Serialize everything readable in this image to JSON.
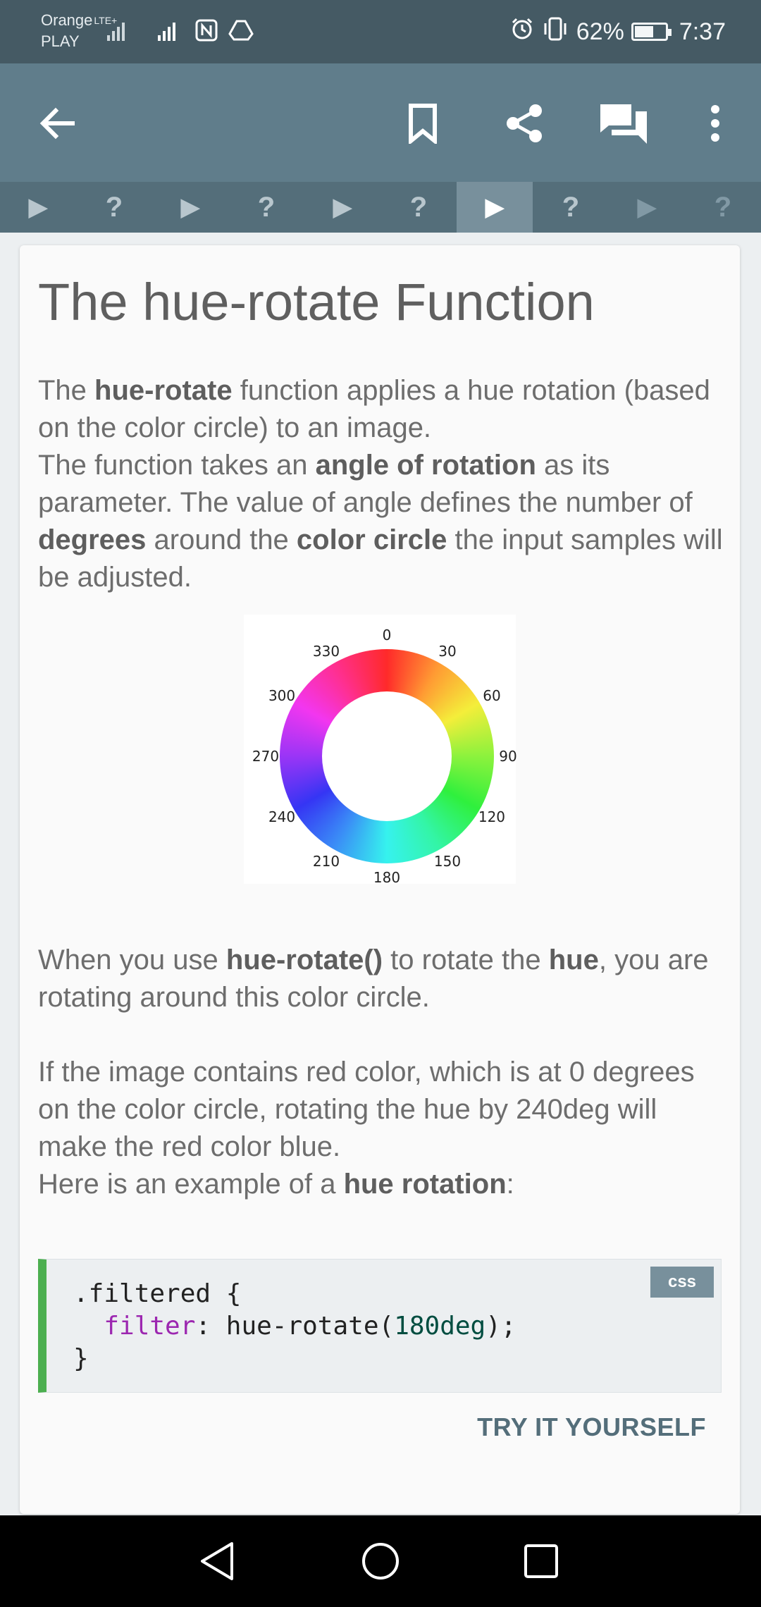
{
  "status_bar": {
    "carrier_line1": "Orange",
    "network_type": "LTE+",
    "carrier_line2": "PLAY",
    "battery_percent": "62%",
    "battery_level": 0.62,
    "time": "7:37",
    "icons": [
      "signal-icon",
      "signal-icon",
      "nfc-icon",
      "drive-icon",
      "alarm-icon",
      "vibrate-icon",
      "battery-icon"
    ]
  },
  "app_bar": {
    "icons": [
      "back-arrow-icon",
      "bookmark-icon",
      "share-icon",
      "chat-icon",
      "more-vert-icon"
    ]
  },
  "step_bar": {
    "items": [
      {
        "symbol": "▶",
        "kind": "play"
      },
      {
        "symbol": "?",
        "kind": "quiz"
      },
      {
        "symbol": "▶",
        "kind": "play"
      },
      {
        "symbol": "?",
        "kind": "quiz"
      },
      {
        "symbol": "▶",
        "kind": "play"
      },
      {
        "symbol": "?",
        "kind": "quiz"
      },
      {
        "symbol": "▶",
        "kind": "play",
        "active": true
      },
      {
        "symbol": "?",
        "kind": "quiz"
      },
      {
        "symbol": "▶",
        "kind": "play",
        "dim": true
      },
      {
        "symbol": "?",
        "kind": "quiz",
        "dim": true
      }
    ]
  },
  "lesson": {
    "title": "The hue-rotate Function",
    "intro": {
      "t1": "The ",
      "b1": "hue-rotate",
      "t2": " function applies a hue rotation (based on the color circle) to an image.",
      "t3": "The function takes an ",
      "b2": "angle of rotation",
      "t4": " as its parameter. The value of angle defines the number of ",
      "b3": "degrees",
      "t5": " around the ",
      "b4": "color circle",
      "t6": " the input samples will be adjusted."
    },
    "color_wheel_labels": [
      "0",
      "30",
      "60",
      "90",
      "120",
      "150",
      "180",
      "210",
      "240",
      "270",
      "300",
      "330"
    ],
    "para2": {
      "t1": "When you use ",
      "b1": "hue-rotate()",
      "t2": " to rotate the ",
      "b2": "hue",
      "t3": ", you are rotating around this color circle."
    },
    "para3": "If the image contains red color, which is at 0 degrees on the color circle, rotating the hue by 240deg will make the red color blue.",
    "para4": {
      "t1": "Here is an example of a ",
      "b1": "hue rotation",
      "t2": ":"
    },
    "code": {
      "lang_tag": "css",
      "line1": ".filtered {",
      "prop": "filter",
      "colon": ": ",
      "func": "hue-rotate(",
      "arg": "180deg",
      "close": ");",
      "line3": "}"
    },
    "try_button": "TRY IT YOURSELF"
  },
  "nav_bar": {
    "icons": [
      "nav-back-icon",
      "nav-home-icon",
      "nav-recents-icon"
    ]
  }
}
